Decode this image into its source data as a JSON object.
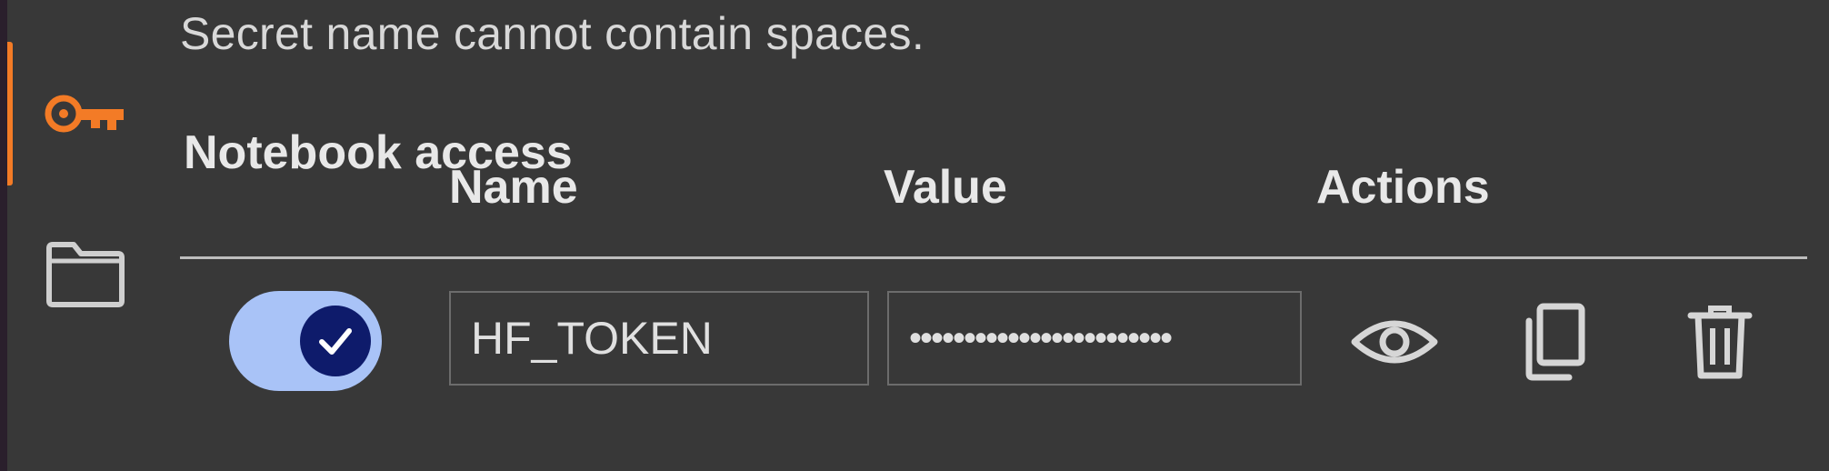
{
  "message": "Secret name cannot contain spaces.",
  "sidebar": {
    "items": [
      {
        "icon": "key-icon",
        "active": true
      },
      {
        "icon": "folder-icon",
        "active": false
      }
    ],
    "accent_color": "#f37b26"
  },
  "table": {
    "headers": {
      "access": "Notebook access",
      "name": "Name",
      "value": "Value",
      "actions": "Actions"
    },
    "rows": [
      {
        "access_enabled": true,
        "name": "HF_TOKEN",
        "value_masked": "••••••••••••••••••••••••",
        "actions": [
          "eye-icon",
          "copy-icon",
          "trash-icon"
        ]
      }
    ]
  },
  "colors": {
    "background": "#383838",
    "toggle_track": "#a9c3f7",
    "toggle_knob": "#0e1b6b",
    "text": "#e3e3e3"
  }
}
